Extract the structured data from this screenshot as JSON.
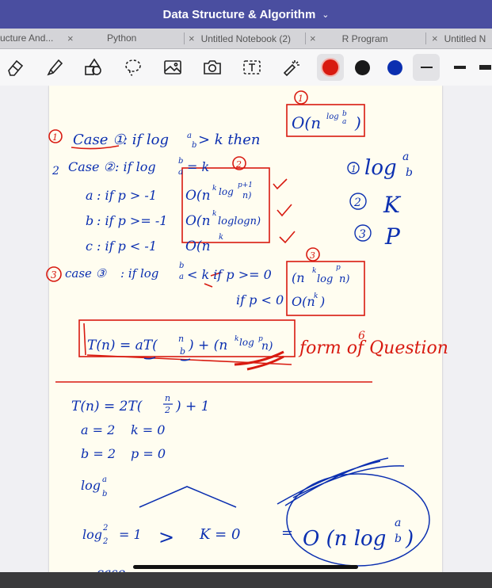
{
  "window": {
    "title": "Data Structure & Algorithm",
    "title_chevron": "⌄"
  },
  "tabs": [
    {
      "label": "ucture And...",
      "close": "×"
    },
    {
      "label": "Python",
      "close": "×"
    },
    {
      "label": "Untitled Notebook (2)",
      "close": "×"
    },
    {
      "label": "R Program",
      "close": "×"
    },
    {
      "label": "Untitled N",
      "close": "×"
    }
  ],
  "toolbar": {
    "tools": [
      "eraser-icon",
      "highlighter-icon",
      "shapes-icon",
      "lasso-icon",
      "image-icon",
      "camera-icon",
      "text-icon",
      "laser-pointer-icon"
    ],
    "pen_colors": [
      "#d81a10",
      "#1a1a1a",
      "#0b2fb0"
    ],
    "active_color": "#d81a10",
    "stroke_widths": [
      "medium",
      "thick"
    ],
    "active_stroke": "medium"
  },
  "notes": {
    "case1": {
      "num": "1",
      "label": "Case ①",
      "cond": ": if  log",
      "sub": "b",
      "sup": "a",
      "rest": " > k   then",
      "result": "O(n",
      "result_sup": "log",
      "result_sub": "a",
      "result_sup2": "b",
      "close": ")",
      "circle_num": "1"
    },
    "case2": {
      "num": "2",
      "label": "Case ②",
      "cond": ": if  log",
      "sub": "a",
      "sup": "b",
      "rest": " = k",
      "circle_num": "2"
    },
    "sub_a": {
      "label": "a",
      "cond": ": if p > -1",
      "result": "O(n",
      "sup": "k",
      "log": "log",
      "sup2": "p+1",
      "n": " n)"
    },
    "sub_b": {
      "label": "b",
      "cond": ": if p >= -1",
      "result": "O(n",
      "sup": "k",
      "log": "loglogn)"
    },
    "sub_c": {
      "label": "c",
      "cond": ": if p < -1",
      "result": "O(n",
      "sup": "k"
    },
    "case3": {
      "num": "3",
      "label": "case ③",
      "cond": ": if  log",
      "sub": "a",
      "sup": "b",
      "rest": " < k  if p >= 0",
      "rest2": "if p < 0",
      "result1": "(n",
      "sup1": "k",
      "log1": "log",
      "sup1b": "p",
      "n1": " n)",
      "result2": "O(n",
      "sup2": "k",
      "close2": ")",
      "circle_num": "3"
    },
    "legend": [
      {
        "num": "1",
        "text": "log",
        "sup": "a",
        "sub": "b"
      },
      {
        "num": "2",
        "text": "K"
      },
      {
        "num": "3",
        "text": "P"
      }
    ],
    "master": {
      "formula": "T(n) = aT(",
      "n": "n",
      "b": "b",
      "rest": ") + (n",
      "k": "k",
      "log": "log",
      "p": "p",
      "n2": "n)",
      "note": "form of  Question",
      "six": "6"
    },
    "example": {
      "eq": "T(n)  =  2T(",
      "n": "n",
      "den": "2",
      "rest": ") + 1",
      "a": "a = 2",
      "k": "k = 0",
      "b": "b = 2",
      "p": "p = 0",
      "log": "log",
      "logsup": "a",
      "logsub": "b",
      "log2": "log",
      "log2sup": "2",
      "log2sub": "2",
      "eq1": "= 1",
      "gt": ">",
      "k0": "K = 0",
      "eqsign": "=",
      "final": "O (n log",
      "final_sup": "a",
      "final_sub": "b",
      "final_close": ")",
      "case_tail": "case"
    }
  }
}
